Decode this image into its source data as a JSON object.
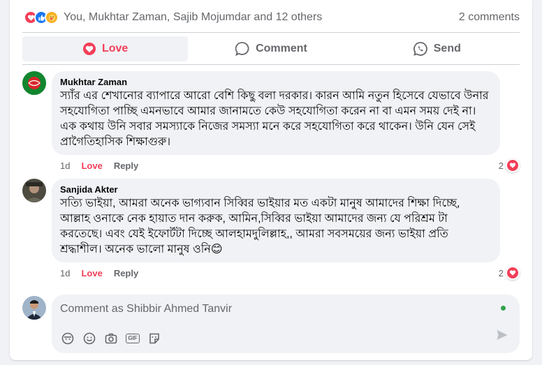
{
  "post_summary": {
    "reacted_by": "You, Mukhtar Zaman, Sajib Mojumdar and 12 others",
    "comment_count": "2 comments",
    "reaction_icons": [
      "love-icon",
      "like-icon",
      "care-icon"
    ]
  },
  "actions": {
    "love": "Love",
    "comment": "Comment",
    "send": "Send"
  },
  "colors": {
    "love_red": "#f33e58",
    "like_blue": "#1877f2",
    "muted": "#65676b",
    "bubble": "#f0f2f5"
  },
  "comments": [
    {
      "author": "Mukhtar Zaman",
      "text": "স্যাঁর এর শেখানোর ব্যাপারে আরো বেশি কিছু বলা দরকার। কারন আমি নতুন হিসেবে যেভাবে উনার সহযোগিতা পাচ্ছি এমনভাবে আমার জানামতে কেউ সহযোগিতা করেন না বা এমন সময় দেই না। এক কথায় উনি সবার সমস্যাকে নিজের সমস্যা মনে করে সহযোগিতা করে থাকেন। উনি যেন সেই প্রাগৈতিহাসিক শিক্ষাগুরু।",
      "time": "1d",
      "love": "Love",
      "reply": "Reply",
      "reaction_count": "2"
    },
    {
      "author": "Sanjida Akter",
      "text": "সত্যি ভাইয়া, আমরা অনেক ভাগ্যবান সিব্বির ভাইয়ার মত একটা মানুষ আমাদের শিক্ষা দিচ্ছে, আল্লাহ ওনাকে নেক হায়াত দান করুক, আমিন,সিব্বির ভাইয়া আমাদের জন্য যে পরিশ্রম টা করতেছে। এবং যেই ইফোর্টটা দিচ্ছে আলহামদুলিল্লাহ,, আমরা সবসময়ের জন্য ভাইয়া প্রতি শ্রদ্ধাশীল। অনেক ভালো মানুষ ওনি😊",
      "time": "1d",
      "love": "Love",
      "reply": "Reply",
      "reaction_count": "2"
    }
  ],
  "composer": {
    "placeholder": "Comment as Shibbir Ahmed Tanvir",
    "tools": [
      "avatar-sticker-icon",
      "emoji-icon",
      "camera-icon",
      "gif-icon",
      "sticker-icon"
    ],
    "gif_label": "GIF"
  }
}
